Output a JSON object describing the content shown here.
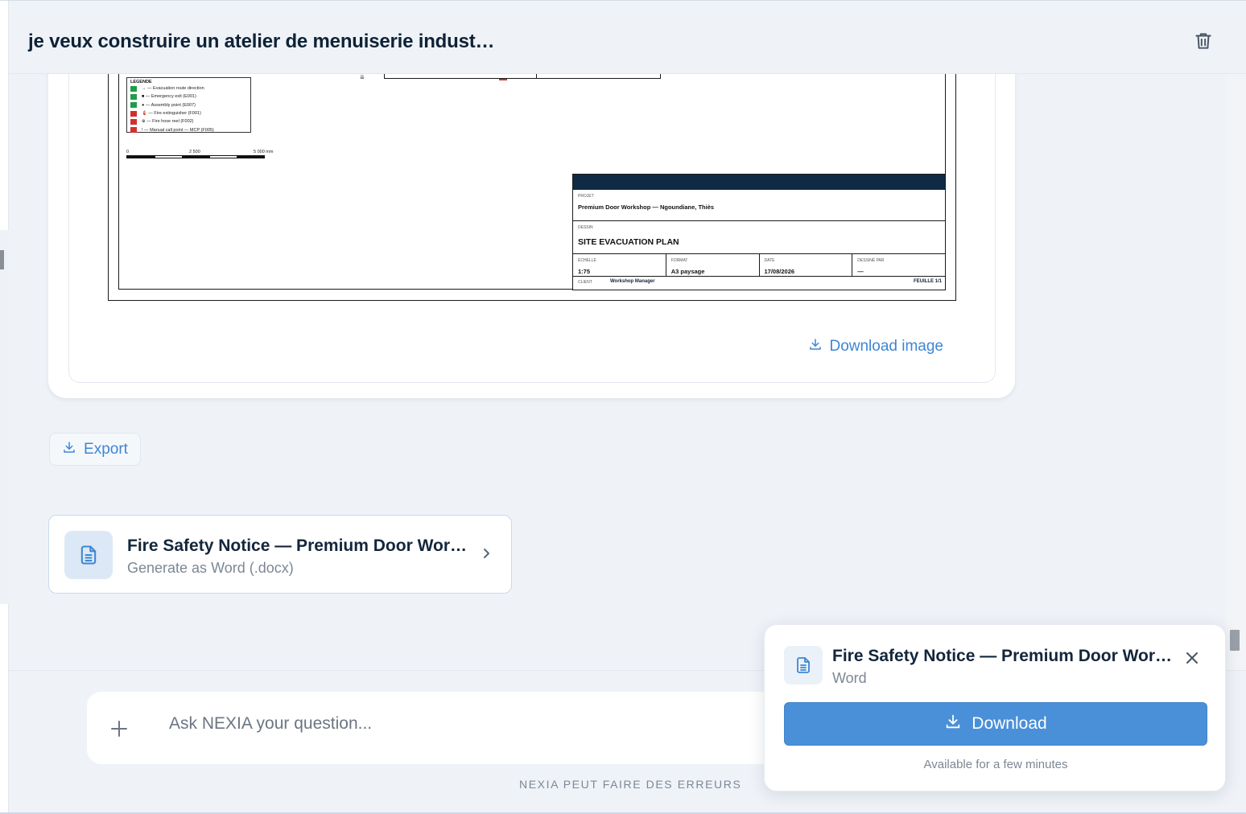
{
  "header": {
    "title": "je veux construire un atelier de menuiserie indust…"
  },
  "plan": {
    "legend": {
      "heading": "LEGENDE",
      "items": [
        {
          "label": "→ — Evacuation route direction",
          "color": "#1f9c4a"
        },
        {
          "label": "■ — Emergency exit (E001)",
          "color": "#1f9c4a"
        },
        {
          "label": "● — Assembly point (E007)",
          "color": "#1f9c4a"
        },
        {
          "label": "🧯 — Fire extinguisher (F001)",
          "color": "#d32f2f"
        },
        {
          "label": "⊕ — Fire hose reel (F002)",
          "color": "#d32f2f"
        },
        {
          "label": "! — Manual call point — MCP (F005)",
          "color": "#d32f2f"
        }
      ]
    },
    "scale": {
      "start": "0",
      "mid": "2 500",
      "end": "5 000 mm"
    },
    "cartouche": {
      "projet_label": "PROJET",
      "projet_value": "Premium Door Workshop — Ngoundiane, Thiès",
      "dessin_label": "DESSIN",
      "dessin_value": "SITE EVACUATION PLAN",
      "echelle_label": "ÉCHELLE",
      "echelle_value": "1:75",
      "format_label": "FORMAT",
      "format_value": "A3 paysage",
      "date_label": "DATE",
      "date_value": "17/08/2026",
      "dessine_label": "DESSINÉ PAR",
      "dessine_value": "—",
      "client_label": "CLIENT",
      "client_value": "Workshop Manager",
      "feuille_value": "FEUILLE 1/1"
    }
  },
  "image_card": {
    "download_label": "Download image"
  },
  "export": {
    "label": "Export"
  },
  "doc_card": {
    "title": "Fire Safety Notice — Premium Door Wor…",
    "subtitle": "Generate as Word (.docx)"
  },
  "composer": {
    "placeholder": "Ask NEXIA your question..."
  },
  "disclaimer": "NEXIA PEUT FAIRE DES ERREURS",
  "toast": {
    "title": "Fire Safety Notice — Premium Door Wor…",
    "subtitle": "Word",
    "download_label": "Download",
    "note": "Available for a few minutes"
  },
  "colors": {
    "accent": "#4a90d9",
    "link": "#3e86d4",
    "background": "#eff3f8",
    "title_band": "#0f2a45"
  }
}
